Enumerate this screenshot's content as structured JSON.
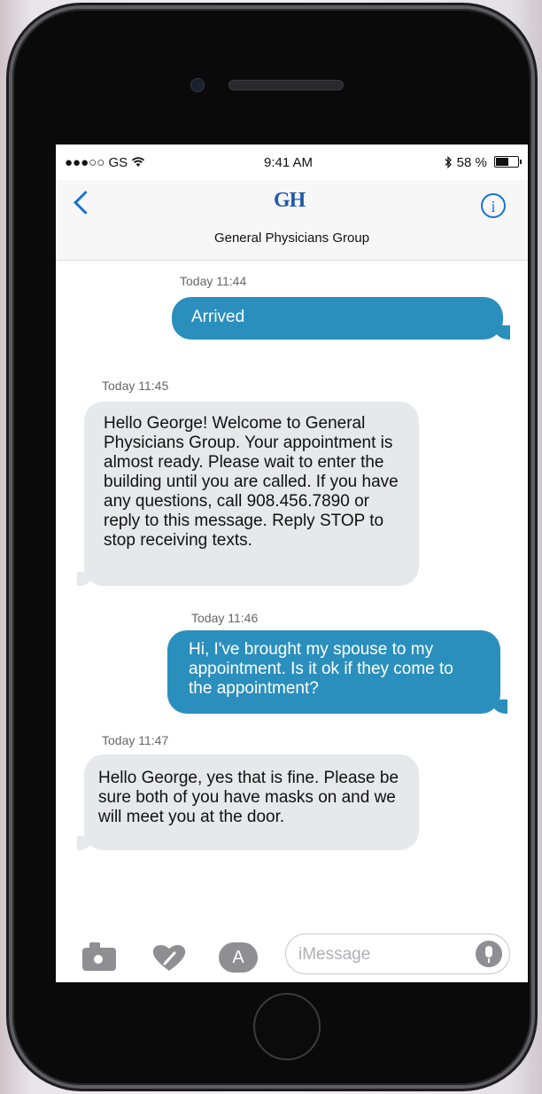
{
  "status_bar": {
    "carrier": "●●●○○ GS",
    "wifi_icon": "wifi-icon",
    "time": "9:41 AM",
    "bluetooth_icon": "bluetooth-icon",
    "battery_percent": "58 %",
    "battery_level": 0.58
  },
  "header": {
    "back_icon": "chevron-left-icon",
    "logo_text": "GH",
    "contact_name": "General Physicians Group",
    "info_icon": "info-icon",
    "info_glyph": "i"
  },
  "messages": [
    {
      "timestamp": "Today 11:44",
      "direction": "outgoing",
      "text": "Arrived"
    },
    {
      "timestamp": "Today 11:45",
      "direction": "incoming",
      "text": "Hello George! Welcome to General Physicians Group. Your appointment is almost ready. Please wait to enter the building until you are called. If you have any questions, call 908.456.7890 or reply to this message. Reply STOP to stop receiving texts."
    },
    {
      "timestamp": "Today 11:46",
      "direction": "outgoing",
      "text": "Hi, I've brought my spouse to my appointment. Is it ok if they come to the appointment?"
    },
    {
      "timestamp": "Today 11:47",
      "direction": "incoming",
      "text": "Hello George, yes that is fine. Please be sure both of you have masks on and we will meet you at the door."
    }
  ],
  "toolbar": {
    "camera_icon": "camera-icon",
    "digital_touch_icon": "heart-icon",
    "app_store_icon": "app-store-icon",
    "app_store_glyph": "A",
    "input_placeholder": "iMessage",
    "mic_icon": "microphone-icon"
  },
  "colors": {
    "outgoing_bubble": "#2a8fbd",
    "incoming_bubble": "#e7e8ec",
    "accent": "#1a73c8"
  }
}
